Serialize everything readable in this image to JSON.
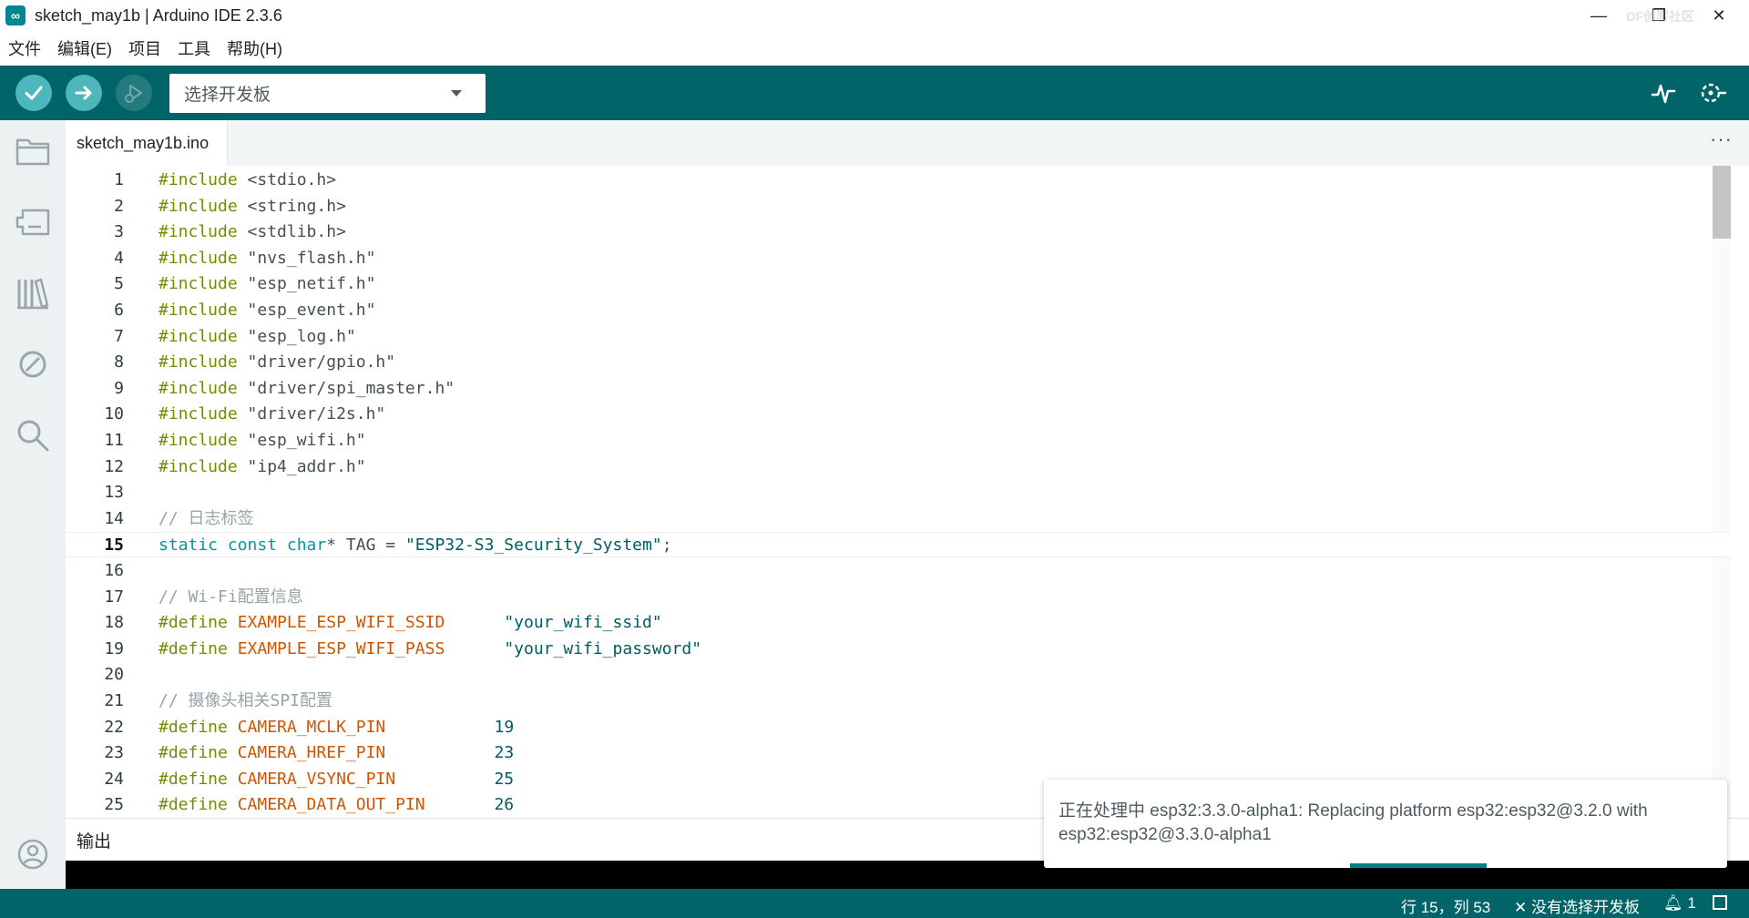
{
  "window": {
    "title": "sketch_may1b | Arduino IDE 2.3.6",
    "watermark": "DF创客社区",
    "restore_glyph": "❐",
    "close_glyph": "✕",
    "minimize_glyph": "—"
  },
  "menu": [
    "文件",
    "编辑(E)",
    "项目",
    "工具",
    "帮助(H)"
  ],
  "toolbar": {
    "board_selector_label": "选择开发板",
    "accent_color": "#006468",
    "button_color": "#4db7bb"
  },
  "tab": {
    "filename": "sketch_may1b.ino",
    "more_label": "···"
  },
  "editor": {
    "current_line": 15,
    "lines": [
      {
        "n": "1",
        "tokens": [
          {
            "t": "#include",
            "c": "kw"
          },
          {
            "t": " <stdio.h>",
            "c": ""
          }
        ]
      },
      {
        "n": "2",
        "tokens": [
          {
            "t": "#include",
            "c": "kw"
          },
          {
            "t": " <string.h>",
            "c": ""
          }
        ]
      },
      {
        "n": "3",
        "tokens": [
          {
            "t": "#include",
            "c": "kw"
          },
          {
            "t": " <stdlib.h>",
            "c": ""
          }
        ]
      },
      {
        "n": "4",
        "tokens": [
          {
            "t": "#include",
            "c": "kw"
          },
          {
            "t": " \"nvs_flash.h\"",
            "c": ""
          }
        ]
      },
      {
        "n": "5",
        "tokens": [
          {
            "t": "#include",
            "c": "kw"
          },
          {
            "t": " \"esp_netif.h\"",
            "c": ""
          }
        ]
      },
      {
        "n": "6",
        "tokens": [
          {
            "t": "#include",
            "c": "kw"
          },
          {
            "t": " \"esp_event.h\"",
            "c": ""
          }
        ]
      },
      {
        "n": "7",
        "tokens": [
          {
            "t": "#include",
            "c": "kw"
          },
          {
            "t": " \"esp_log.h\"",
            "c": ""
          }
        ]
      },
      {
        "n": "8",
        "tokens": [
          {
            "t": "#include",
            "c": "kw"
          },
          {
            "t": " \"driver/gpio.h\"",
            "c": ""
          }
        ]
      },
      {
        "n": "9",
        "tokens": [
          {
            "t": "#include",
            "c": "kw"
          },
          {
            "t": " \"driver/spi_master.h\"",
            "c": ""
          }
        ]
      },
      {
        "n": "10",
        "tokens": [
          {
            "t": "#include",
            "c": "kw"
          },
          {
            "t": " \"driver/i2s.h\"",
            "c": ""
          }
        ]
      },
      {
        "n": "11",
        "tokens": [
          {
            "t": "#include",
            "c": "kw"
          },
          {
            "t": " \"esp_wifi.h\"",
            "c": ""
          }
        ]
      },
      {
        "n": "12",
        "tokens": [
          {
            "t": "#include",
            "c": "kw"
          },
          {
            "t": " \"ip4_addr.h\"",
            "c": ""
          }
        ]
      },
      {
        "n": "13",
        "tokens": []
      },
      {
        "n": "14",
        "tokens": [
          {
            "t": "// 日志标签",
            "c": "cmt"
          }
        ]
      },
      {
        "n": "15",
        "tokens": [
          {
            "t": "static const char",
            "c": "typ"
          },
          {
            "t": "* TAG = ",
            "c": ""
          },
          {
            "t": "\"ESP32-S3_Security_System\"",
            "c": "str"
          },
          {
            "t": ";",
            "c": ""
          }
        ]
      },
      {
        "n": "16",
        "tokens": []
      },
      {
        "n": "17",
        "tokens": [
          {
            "t": "// Wi-Fi配置信息",
            "c": "cmt"
          }
        ]
      },
      {
        "n": "18",
        "tokens": [
          {
            "t": "#define",
            "c": "kw"
          },
          {
            "t": " ",
            "c": ""
          },
          {
            "t": "EXAMPLE_ESP_WIFI_SSID",
            "c": "mac"
          },
          {
            "t": "      ",
            "c": ""
          },
          {
            "t": "\"your_wifi_ssid\"",
            "c": "str"
          }
        ]
      },
      {
        "n": "19",
        "tokens": [
          {
            "t": "#define",
            "c": "kw"
          },
          {
            "t": " ",
            "c": ""
          },
          {
            "t": "EXAMPLE_ESP_WIFI_PASS",
            "c": "mac"
          },
          {
            "t": "      ",
            "c": ""
          },
          {
            "t": "\"your_wifi_password\"",
            "c": "str"
          }
        ]
      },
      {
        "n": "20",
        "tokens": []
      },
      {
        "n": "21",
        "tokens": [
          {
            "t": "// 摄像头相关SPI配置",
            "c": "cmt"
          }
        ]
      },
      {
        "n": "22",
        "tokens": [
          {
            "t": "#define",
            "c": "kw"
          },
          {
            "t": " ",
            "c": ""
          },
          {
            "t": "CAMERA_MCLK_PIN",
            "c": "mac"
          },
          {
            "t": "           ",
            "c": ""
          },
          {
            "t": "19",
            "c": "num"
          }
        ]
      },
      {
        "n": "23",
        "tokens": [
          {
            "t": "#define",
            "c": "kw"
          },
          {
            "t": " ",
            "c": ""
          },
          {
            "t": "CAMERA_HREF_PIN",
            "c": "mac"
          },
          {
            "t": "           ",
            "c": ""
          },
          {
            "t": "23",
            "c": "num"
          }
        ]
      },
      {
        "n": "24",
        "tokens": [
          {
            "t": "#define",
            "c": "kw"
          },
          {
            "t": " ",
            "c": ""
          },
          {
            "t": "CAMERA_VSYNC_PIN",
            "c": "mac"
          },
          {
            "t": "          ",
            "c": ""
          },
          {
            "t": "25",
            "c": "num"
          }
        ]
      },
      {
        "n": "25",
        "tokens": [
          {
            "t": "#define",
            "c": "kw"
          },
          {
            "t": " ",
            "c": ""
          },
          {
            "t": "CAMERA_DATA_OUT_PIN",
            "c": "mac"
          },
          {
            "t": "       ",
            "c": ""
          },
          {
            "t": "26",
            "c": "num"
          }
        ]
      }
    ]
  },
  "output": {
    "label": "输出"
  },
  "notification": {
    "text": "正在处理中 esp32:3.3.0-alpha1: Replacing platform esp32:esp32@3.2.0 with esp32:esp32@3.3.0-alpha1"
  },
  "status": {
    "cursor_position": "行 15，列 53",
    "board_status": "✕ 没有选择开发板",
    "notification_count": "1"
  }
}
